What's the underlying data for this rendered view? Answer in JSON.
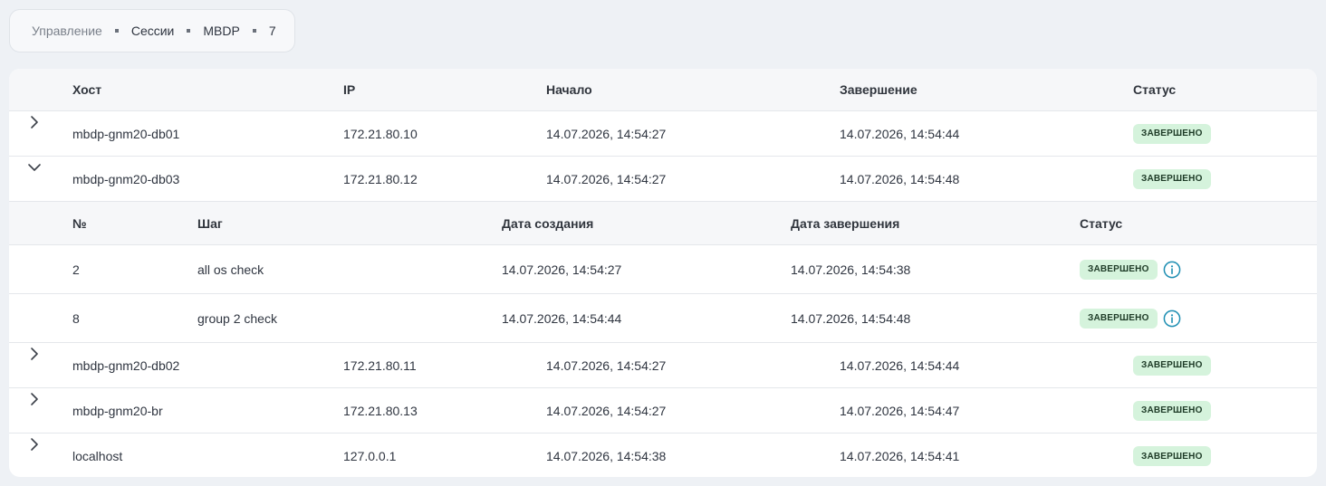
{
  "breadcrumb": [
    "Управление",
    "Сессии",
    "MBDP",
    "7"
  ],
  "table": {
    "headers": [
      "Хост",
      "IP",
      "Начало",
      "Завершение",
      "Статус"
    ],
    "rows": [
      {
        "host": "mbdp-gnm20-db01",
        "ip": "172.21.80.10",
        "start": "14.07.2026, 14:54:27",
        "end": "14.07.2026, 14:54:44",
        "status": "ЗАВЕРШЕНО",
        "expanded": false
      },
      {
        "host": "mbdp-gnm20-db03",
        "ip": "172.21.80.12",
        "start": "14.07.2026, 14:54:27",
        "end": "14.07.2026, 14:54:48",
        "status": "ЗАВЕРШЕНО",
        "expanded": true
      },
      {
        "host": "mbdp-gnm20-db02",
        "ip": "172.21.80.11",
        "start": "14.07.2026, 14:54:27",
        "end": "14.07.2026, 14:54:44",
        "status": "ЗАВЕРШЕНО",
        "expanded": false
      },
      {
        "host": "mbdp-gnm20-br",
        "ip": "172.21.80.13",
        "start": "14.07.2026, 14:54:27",
        "end": "14.07.2026, 14:54:47",
        "status": "ЗАВЕРШЕНО",
        "expanded": false
      },
      {
        "host": "localhost",
        "ip": "127.0.0.1",
        "start": "14.07.2026, 14:54:38",
        "end": "14.07.2026, 14:54:41",
        "status": "ЗАВЕРШЕНО",
        "expanded": false
      }
    ]
  },
  "steps": {
    "headers": [
      "№",
      "Шаг",
      "Дата создания",
      "Дата завершения",
      "Статус"
    ],
    "rows": [
      {
        "num": "2",
        "step": "all os check",
        "created": "14.07.2026, 14:54:27",
        "finished": "14.07.2026, 14:54:38",
        "status": "ЗАВЕРШЕНО"
      },
      {
        "num": "8",
        "step": "group 2 check",
        "created": "14.07.2026, 14:54:44",
        "finished": "14.07.2026, 14:54:48",
        "status": "ЗАВЕРШЕНО"
      }
    ]
  },
  "colors": {
    "badge_bg": "#d5f3dc",
    "info_icon": "#1f8fb3",
    "page_bg": "#eef1f5"
  },
  "icons": {
    "collapsed": "chevron-right-icon",
    "expanded": "chevron-down-icon",
    "info": "info-icon"
  }
}
